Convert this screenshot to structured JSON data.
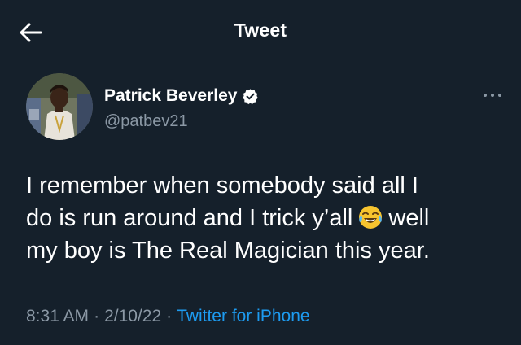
{
  "header": {
    "title": "Tweet",
    "back_icon": "arrow-left-icon"
  },
  "author": {
    "display_name": "Patrick Beverley",
    "handle": "@patbev21",
    "verified": true,
    "verified_icon": "verified-badge-icon",
    "avatar_icon": "avatar-photo"
  },
  "more_icon": "more-horizontal-icon",
  "tweet": {
    "line1": "I remember when somebody said all I",
    "line2_before_emoji": "do is run around and I trick y’all",
    "emoji_icon": "face-with-tears-of-joy-icon",
    "line2_after_emoji": "well",
    "line3": "my boy is The Real Magician this year."
  },
  "meta": {
    "time": "8:31 AM",
    "separator": "·",
    "date": "2/10/22",
    "source": "Twitter for iPhone"
  },
  "colors": {
    "background": "#15202b",
    "text_primary": "#ffffff",
    "text_secondary": "#8b98a5",
    "accent": "#1d9bf0"
  }
}
